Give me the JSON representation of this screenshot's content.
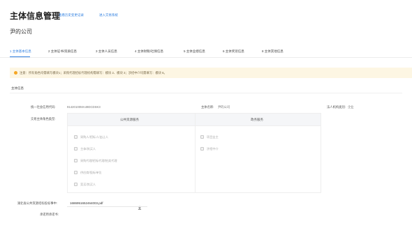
{
  "header": {
    "title": "主体信息管理",
    "link_history": "查看历史变更记录",
    "link_enter_system": "进入交易系统",
    "company_name": "尹的公司"
  },
  "tabs": [
    {
      "label": "1 主体基本信息",
      "active": true
    },
    {
      "label": "2 主体证书/资质信息",
      "active": false
    },
    {
      "label": "3 主体人员信息",
      "active": false
    },
    {
      "label": "4 主体财税/社保信息",
      "active": false
    },
    {
      "label": "5 主体业绩信息",
      "active": false
    },
    {
      "label": "6 主体奖惩信息",
      "active": false
    },
    {
      "label": "8 主体其他信息",
      "active": false
    }
  ],
  "notice": {
    "icon": "warning-icon",
    "text": "注意：所有角色均需填写模块1；采购代理招标代理机构需填写：模块 2、模块 3；涉招中介均需填写：模块 8。"
  },
  "section": {
    "title": "主体信息"
  },
  "fields": {
    "credit_code_label": "统一社会信用代码:",
    "credit_code_value": "91420100MA49DCDSK3",
    "entity_name_label": "主体名称:",
    "entity_name_value": "尹的公司",
    "legal_type_label": "法人机构类别:",
    "legal_type_value": "企业",
    "role_type_label": "交易主体角色类型:"
  },
  "role_grid": {
    "col_public": "公共资源服务",
    "col_government": "政务服务",
    "public_options": [
      "采购人/招标人/出让人",
      "主体/其买人",
      "采购代理/招标代理/拍卖代理",
      "供应商/投标单位",
      "竞买/其买人"
    ],
    "government_options": [
      "项目业主",
      "涉招中介"
    ]
  },
  "attachment": {
    "label": "湖北省公共资源招标投标事中:",
    "file_name": "1686951652464003.pdf",
    "download_icon": "download-icon",
    "contract_label": "承诺用承诺书:"
  },
  "colors": {
    "accent": "#2f7fe0",
    "notice_bg": "#fdf6e3",
    "warning": "#f5a623"
  }
}
